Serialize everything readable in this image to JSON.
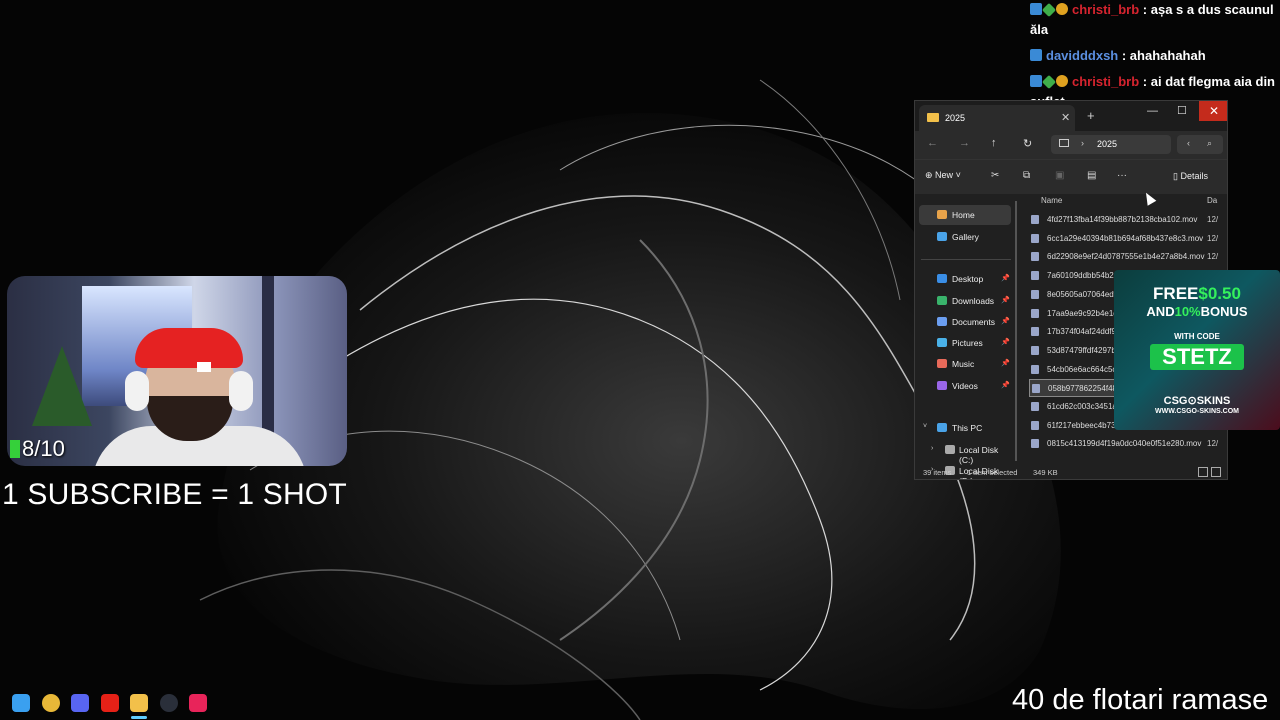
{
  "chat": [
    {
      "user": "christi_brb",
      "text": ": așa s a dus scaunul ăla",
      "color": "#d6242f",
      "badges": [
        "blue",
        "green",
        "gold"
      ]
    },
    {
      "user": "davidddxsh",
      "text": ": ahahahahah",
      "color": "#5b8fe0",
      "badges": [
        "blue"
      ]
    },
    {
      "user": "christi_brb",
      "text": ": ai dat flegma aia din suflet",
      "color": "#d6242f",
      "badges": [
        "blue",
        "green",
        "gold"
      ]
    }
  ],
  "overlay": {
    "shot_counter": "8/10",
    "subscribe_text": "1 SUBSCRIBE = 1 SHOT",
    "pushups_text": "40 de flotari ramase"
  },
  "explorer": {
    "tab_title": "2025",
    "address": "2025",
    "toolbar": {
      "new_label": "New",
      "details_label": "Details"
    },
    "sidebar": [
      {
        "label": "Home",
        "icon": "home-icon",
        "color": "#e8a34a",
        "pinned": false,
        "selected": true
      },
      {
        "label": "Gallery",
        "icon": "gallery-icon",
        "color": "#4aa3e8",
        "pinned": false
      },
      {
        "label": "Desktop",
        "icon": "desktop-icon",
        "color": "#3a8ee6",
        "pinned": true
      },
      {
        "label": "Downloads",
        "icon": "downloads-icon",
        "color": "#39b36b",
        "pinned": true
      },
      {
        "label": "Documents",
        "icon": "documents-icon",
        "color": "#6b9ef0",
        "pinned": true
      },
      {
        "label": "Pictures",
        "icon": "pictures-icon",
        "color": "#4ab1e8",
        "pinned": true
      },
      {
        "label": "Music",
        "icon": "music-icon",
        "color": "#e86a5a",
        "pinned": true
      },
      {
        "label": "Videos",
        "icon": "videos-icon",
        "color": "#9a66e8",
        "pinned": true
      },
      {
        "label": "This PC",
        "icon": "pc-icon",
        "color": "#4aa3e8",
        "pinned": false
      },
      {
        "label": "Local Disk (C:)",
        "icon": "disk-icon",
        "color": "#aaaaaa",
        "pinned": false
      },
      {
        "label": "Local Disk (D:)",
        "icon": "disk-icon",
        "color": "#aaaaaa",
        "pinned": false
      }
    ],
    "columns": {
      "name": "Name",
      "date": "Da"
    },
    "files": [
      {
        "name": "4fd27f13fba14f39bb887b2138cba102.mov",
        "date": "12/"
      },
      {
        "name": "6cc1a29e40394b81b694af68b437e8c3.mov",
        "date": "12/"
      },
      {
        "name": "6d22908e9ef24d0787555e1b4e27a8b4.mov",
        "date": "12/"
      },
      {
        "name": "7a60109ddbb54b2d",
        "date": ""
      },
      {
        "name": "8e05605a07064edf",
        "date": ""
      },
      {
        "name": "17aa9ae9c92b4e1d9",
        "date": ""
      },
      {
        "name": "17b374f04af24ddf9",
        "date": ""
      },
      {
        "name": "53d87479ffdf4297b",
        "date": ""
      },
      {
        "name": "54cb06e6ac664c5c9",
        "date": ""
      },
      {
        "name": "058b977862254f488",
        "date": "",
        "selected": true
      },
      {
        "name": "61cd62c003c3451ab",
        "date": ""
      },
      {
        "name": "61f217ebbeec4b739",
        "date": ""
      },
      {
        "name": "0815c413199d4f19a0dc040e0f51e280.mov",
        "date": "12/"
      }
    ],
    "status": {
      "count": "39 items",
      "selected": "1 item selected",
      "size": "349 KB"
    }
  },
  "ad": {
    "line1_a": "FREE",
    "line1_b": "$0.50",
    "line2_a": "AND",
    "line2_b": "10%",
    "line2_c": "BONUS",
    "with_code": "WITH CODE",
    "code": "STETZ",
    "brand": "CSG⊙SKINS",
    "url": "WWW.CSGO-SKINS.COM"
  },
  "taskbar": [
    {
      "name": "start-icon",
      "color": "#3aa0f0"
    },
    {
      "name": "chrome-icon",
      "color": "#e8b838"
    },
    {
      "name": "discord-icon",
      "color": "#5865f2"
    },
    {
      "name": "youtube-icon",
      "color": "#e62117"
    },
    {
      "name": "file-explorer-icon",
      "color": "#f2c04a"
    },
    {
      "name": "steam-icon",
      "color": "#2a2f3a"
    },
    {
      "name": "tiktok-icon",
      "color": "#e8245a"
    }
  ]
}
